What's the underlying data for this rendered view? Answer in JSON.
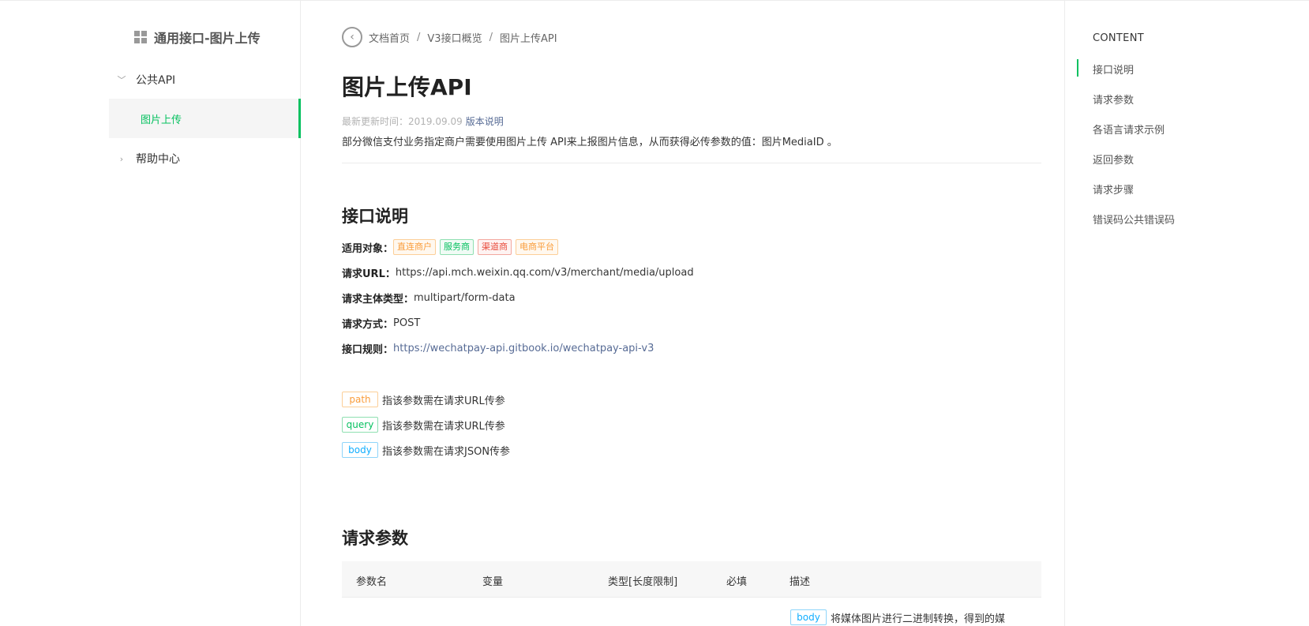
{
  "sidebar": {
    "title": "通用接口-图片上传",
    "groups": [
      {
        "label": "公共API",
        "expanded": true,
        "items": [
          {
            "label": "图片上传",
            "active": true
          }
        ]
      },
      {
        "label": "帮助中心",
        "expanded": false,
        "items": []
      }
    ]
  },
  "breadcrumb": [
    "文档首页",
    "V3接口概览",
    "图片上传API"
  ],
  "page": {
    "title": "图片上传API",
    "updated_prefix": "最新更新时间：2019.09.09",
    "version_link": "版本说明",
    "intro": "部分微信支付业务指定商户需要使用图片上传 API来上报图片信息，从而获得必传参数的值：图片MediaID 。"
  },
  "section1": {
    "title": "接口说明",
    "applies_label": "适用对象：",
    "applies_tags": [
      "直连商户",
      "服务商",
      "渠道商",
      "电商平台"
    ],
    "url_label": "请求URL：",
    "url_value": "https://api.mch.weixin.qq.com/v3/merchant/media/upload",
    "content_type_label": "请求主体类型：",
    "content_type_value": "multipart/form-data",
    "method_label": "请求方式：",
    "method_value": "POST",
    "rules_label": "接口规则：",
    "rules_link": "https://wechatpay-api.gitbook.io/wechatpay-api-v3"
  },
  "param_legend": [
    {
      "tag": "path",
      "text": "指该参数需在请求URL传参"
    },
    {
      "tag": "query",
      "text": "指该参数需在请求URL传参"
    },
    {
      "tag": "body",
      "text": "指该参数需在请求JSON传参"
    }
  ],
  "section2": {
    "title": "请求参数",
    "columns": [
      "参数名",
      "变量",
      "类型[长度限制]",
      "必填",
      "描述"
    ],
    "first_row": {
      "tag": "body",
      "desc": "将媒体图片进行二进制转换，得到的媒"
    }
  },
  "toc": {
    "title": "CONTENT",
    "items": [
      "接口说明",
      "请求参数",
      "各语言请求示例",
      "返回参数",
      "请求步骤",
      "错误码公共错误码"
    ],
    "active_index": 0
  },
  "colors": {
    "accent": "#07c160",
    "link": "#576b95",
    "orange": "#fa9d3b",
    "red": "#e84c3d",
    "blue": "#10aeff"
  }
}
